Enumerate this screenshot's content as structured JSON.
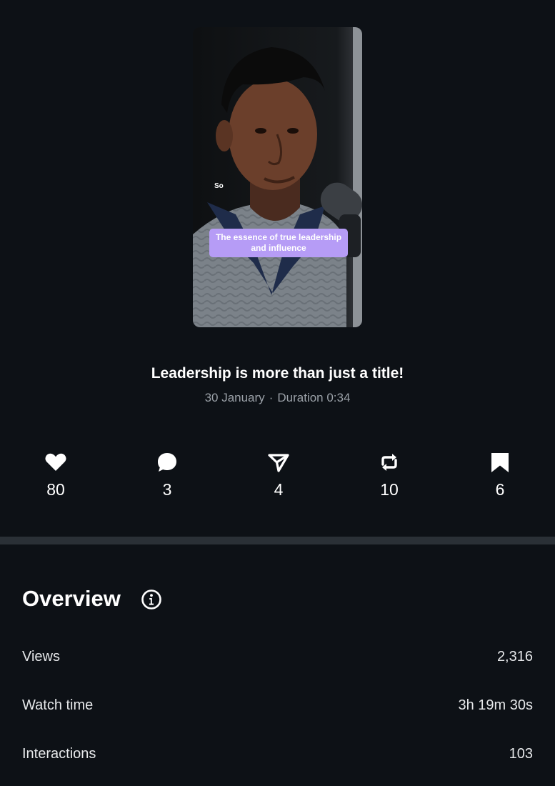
{
  "video": {
    "caption_small": "So",
    "caption_box": "The essence of true leadership and influence",
    "title": "Leadership is more than just a title!",
    "date": "30 January",
    "separator": "·",
    "duration": "Duration 0:34"
  },
  "stats": [
    {
      "icon": "heart-icon",
      "value": "80"
    },
    {
      "icon": "comment-icon",
      "value": "3"
    },
    {
      "icon": "share-icon",
      "value": "4"
    },
    {
      "icon": "repost-icon",
      "value": "10"
    },
    {
      "icon": "bookmark-icon",
      "value": "6"
    }
  ],
  "overview": {
    "title": "Overview",
    "metrics": [
      {
        "label": "Views",
        "value": "2,316"
      },
      {
        "label": "Watch time",
        "value": "3h 19m 30s"
      },
      {
        "label": "Interactions",
        "value": "103"
      }
    ]
  },
  "colors": {
    "background": "#0d1116",
    "divider": "#2a3036",
    "caption_box": "#b69cf6",
    "muted_text": "#9aa0a7"
  }
}
